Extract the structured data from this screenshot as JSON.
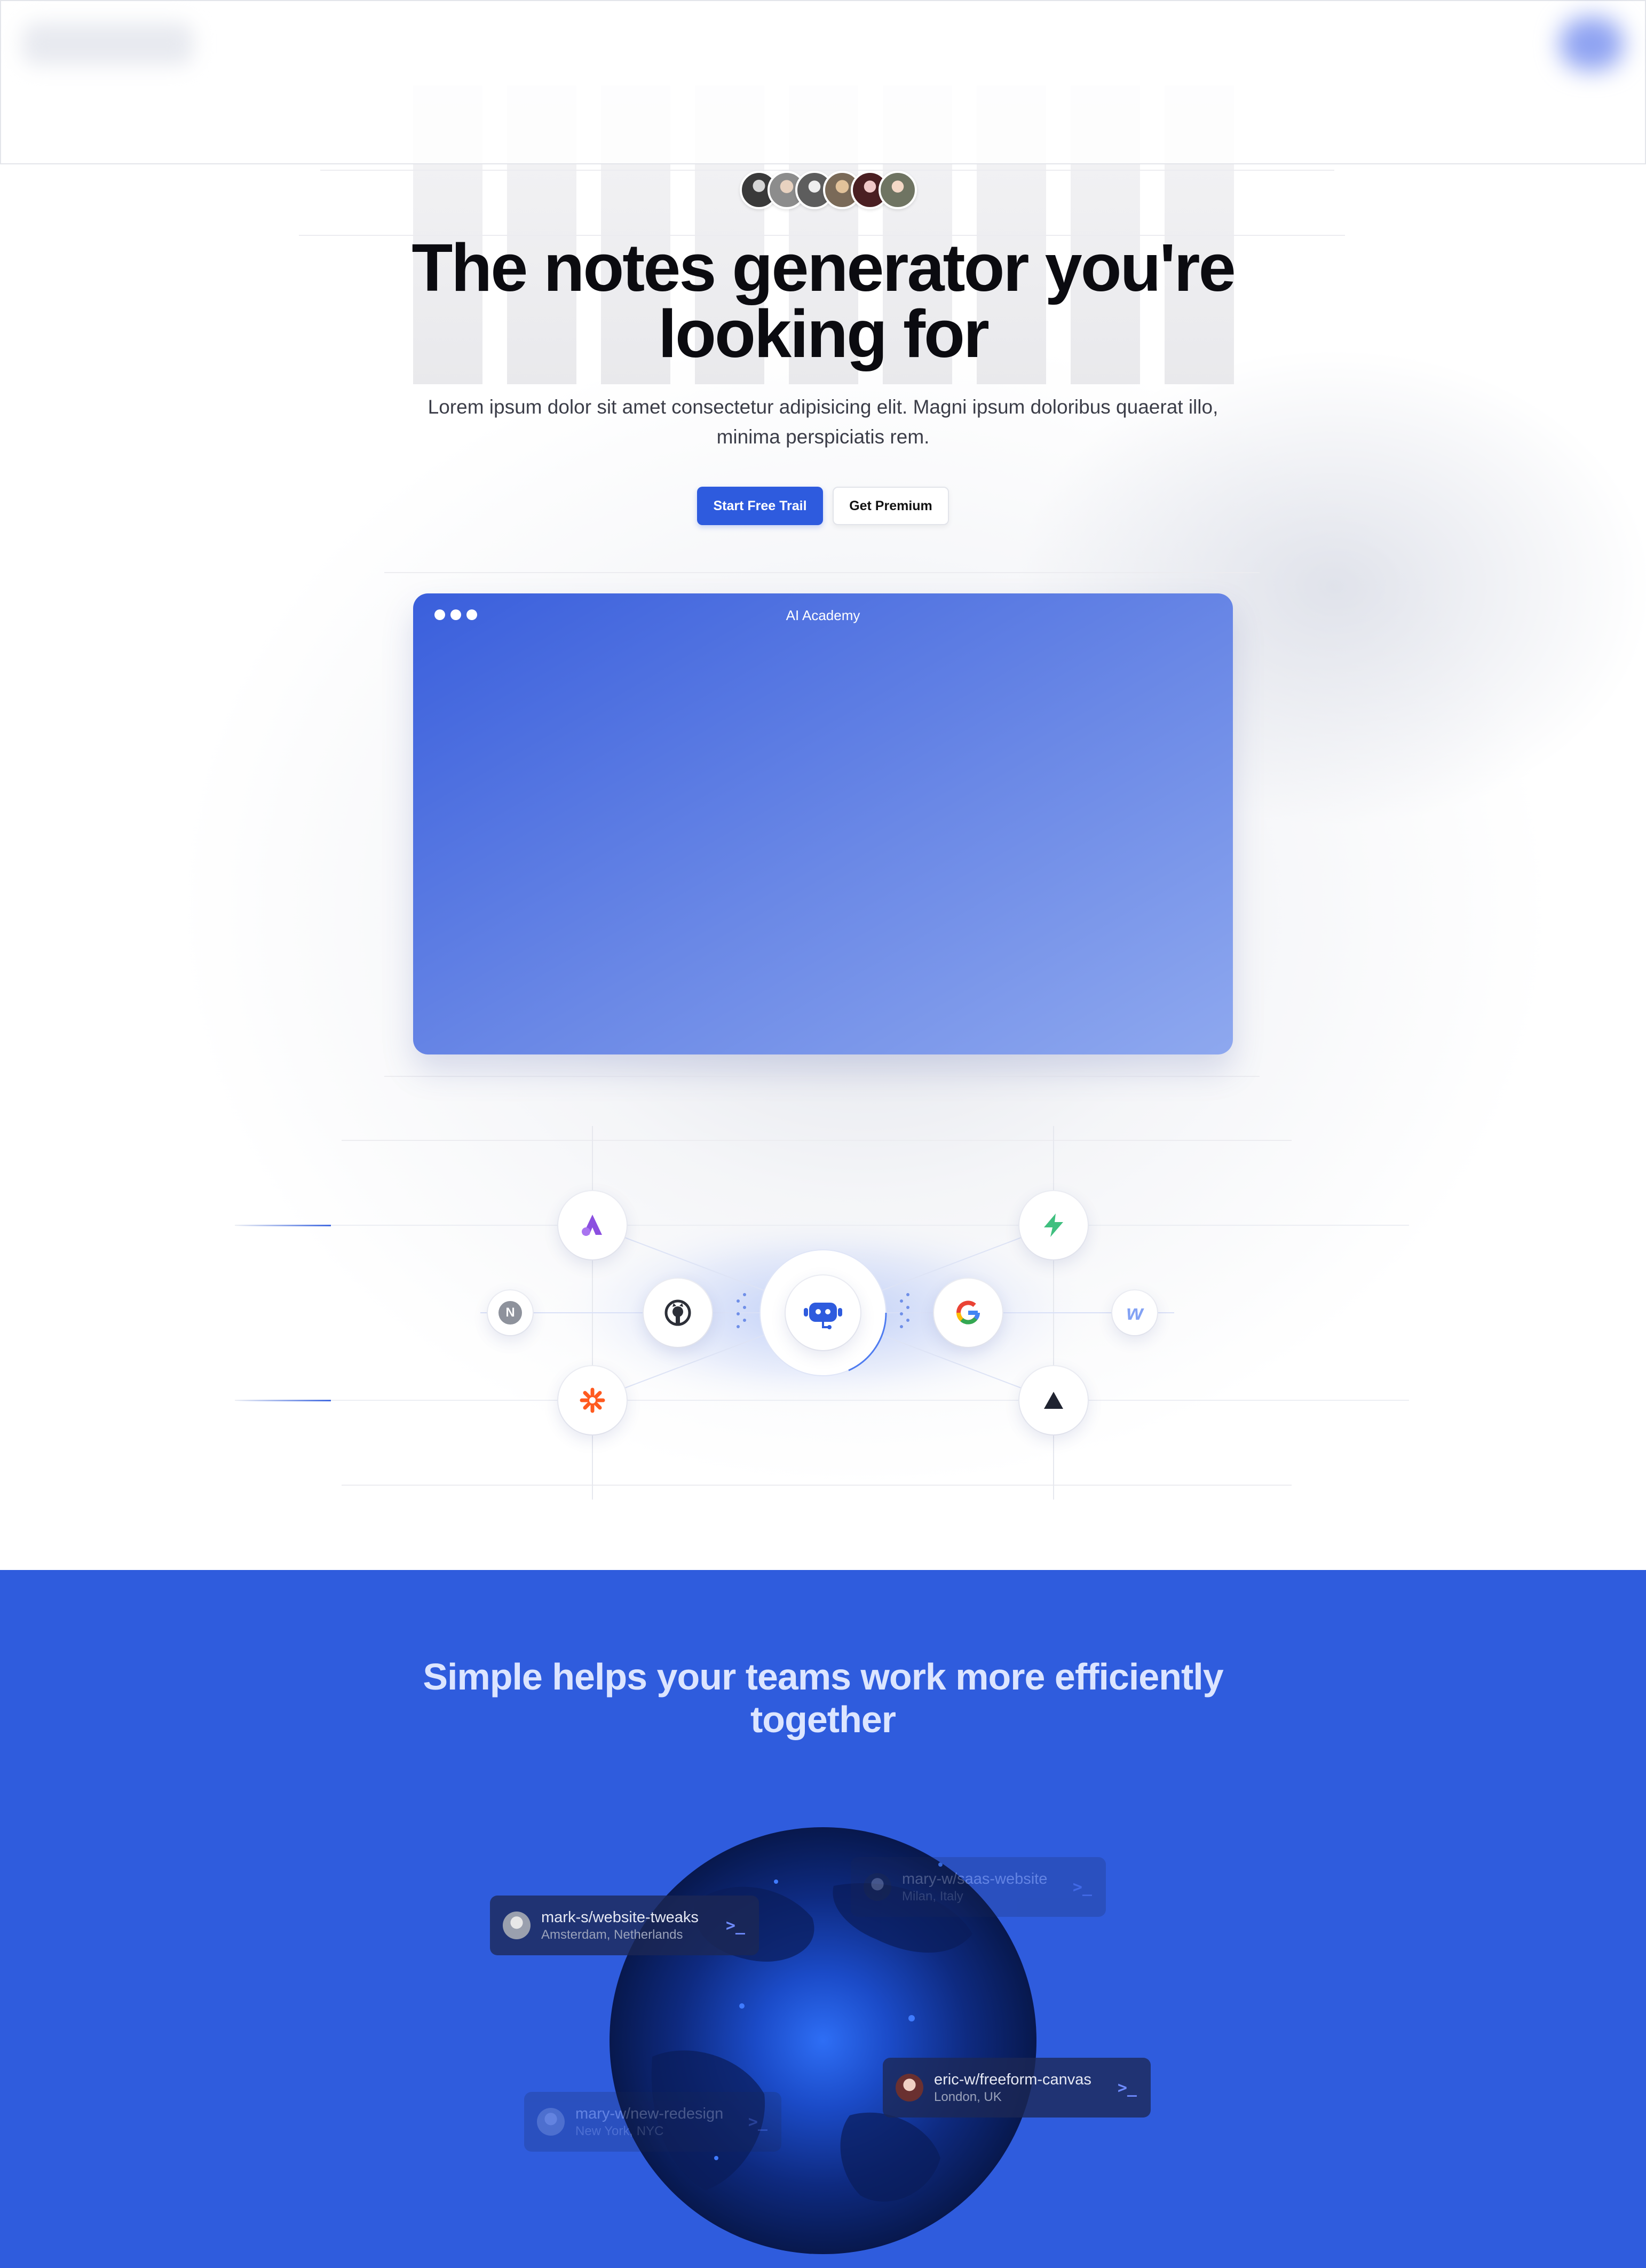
{
  "hero": {
    "avatar_count": 6,
    "title_line1": "The notes generator you're",
    "title_line2": "looking for",
    "subtitle_line1": "Lorem ipsum dolor sit amet consectetur adipisicing elit. Magni ipsum doloribus quaerat illo,",
    "subtitle_line2": "minima perspiciatis rem.",
    "primary_button": "Start Free Trail",
    "secondary_button": "Get Premium"
  },
  "app_window": {
    "title": "AI Academy"
  },
  "integrations": {
    "center_icon": "bot-icon",
    "items": [
      "ally-icon",
      "bolt-icon",
      "notion-icon",
      "github-icon",
      "google-icon",
      "webflow-icon",
      "zapier-icon",
      "vercel-icon"
    ],
    "notion_letter": "N",
    "google_letter": "G",
    "webflow_letter": "w",
    "colors": {
      "primary": "#2e5bde",
      "ally": "#8b4fe0",
      "bolt": "#3fbf7f",
      "zapier": "#ff5a1f"
    }
  },
  "blue_section": {
    "title_line1": "Simple helps your teams work more efficiently",
    "title_line2": "together",
    "background": "#2f5cdd",
    "cards": [
      {
        "title": "mark-s/website-tweaks",
        "subtitle": "Amsterdam, Netherlands"
      },
      {
        "title": "mary-w/saas-website",
        "subtitle": "Milan, Italy"
      },
      {
        "title": "eric-w/freeform-canvas",
        "subtitle": "London, UK"
      },
      {
        "title": "mary-w/new-redesign",
        "subtitle": "New York, NYC"
      }
    ],
    "terminal_glyph": ">_"
  }
}
